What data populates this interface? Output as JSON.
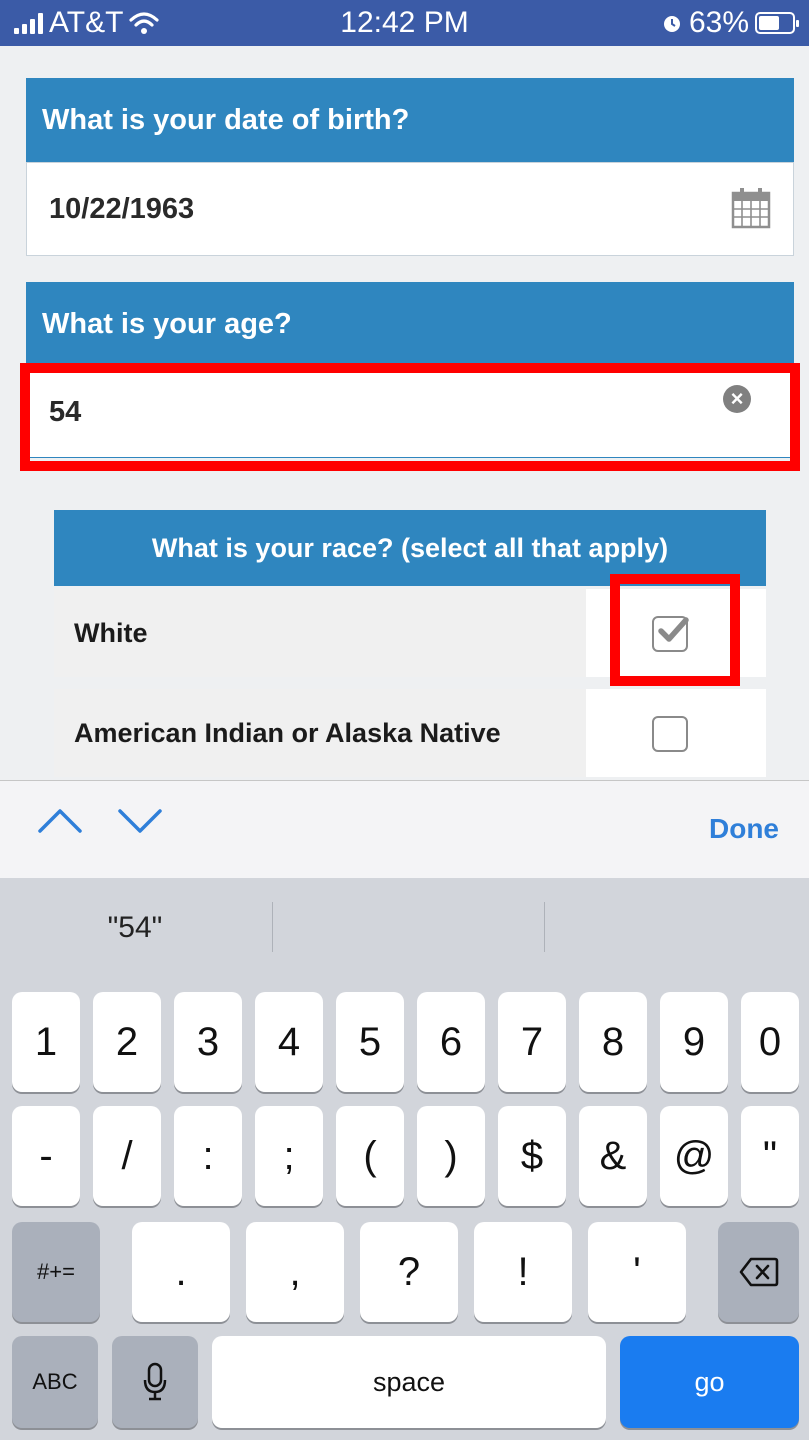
{
  "status_bar": {
    "carrier": "AT&T",
    "time": "12:42 PM",
    "battery": "63%",
    "battery_level": 0.63
  },
  "form": {
    "dob": {
      "question": "What is your date of birth?",
      "value": "10/22/1963",
      "icon": "calendar-icon"
    },
    "age": {
      "question": "What is your age?",
      "value": "54",
      "icon": "clear-icon"
    },
    "race": {
      "question": "What is your race? (select all that apply)",
      "options": [
        {
          "label": "White",
          "checked": true
        },
        {
          "label": "American Indian or Alaska Native",
          "checked": false
        }
      ]
    }
  },
  "accessory": {
    "up_icon": "chevron-up-icon",
    "down_icon": "chevron-down-icon",
    "done_label": "Done",
    "accent_color": "#2f7fd9"
  },
  "keyboard": {
    "suggestions": [
      "\"54\"",
      "",
      ""
    ],
    "row1": [
      "1",
      "2",
      "3",
      "4",
      "5",
      "6",
      "7",
      "8",
      "9",
      "0"
    ],
    "row2": [
      "-",
      "/",
      ":",
      ";",
      "(",
      ")",
      "$",
      "&",
      "@",
      "\""
    ],
    "row3": {
      "mode_label": "#+=",
      "keys": [
        ".",
        ",",
        "?",
        "!",
        "'"
      ],
      "delete_icon": "backspace-icon"
    },
    "row4": {
      "abc_label": "ABC",
      "mic_icon": "microphone-icon",
      "space_label": "space",
      "go_label": "go",
      "go_color": "#1a7cf0"
    }
  }
}
